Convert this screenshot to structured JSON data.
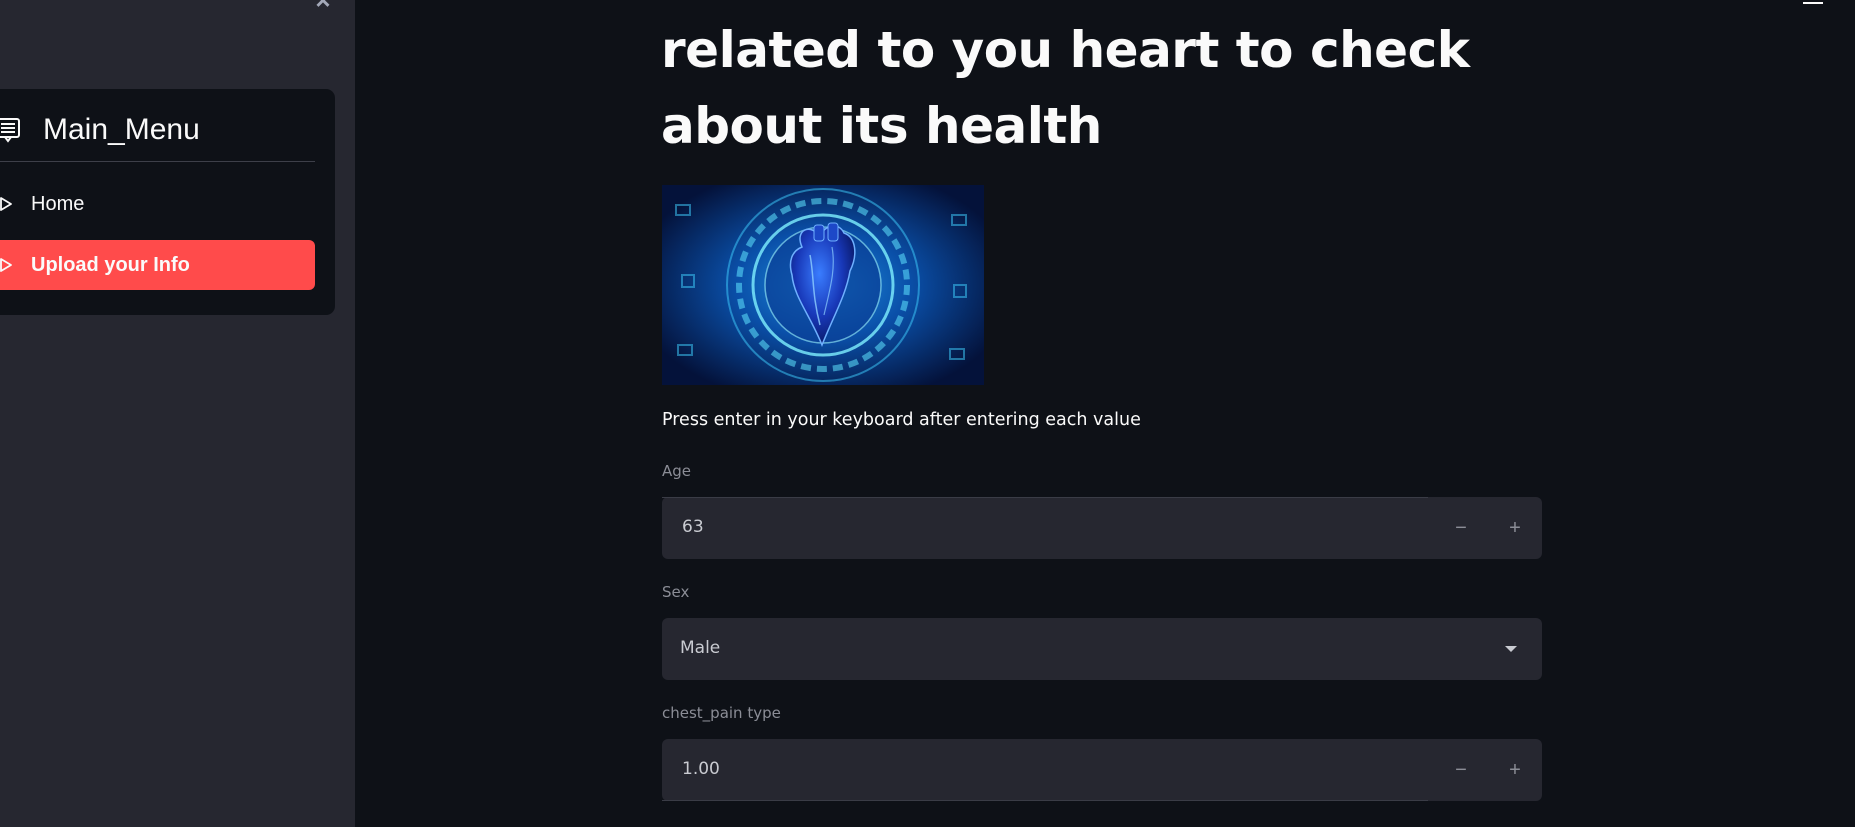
{
  "sidebar": {
    "close_glyph": "×",
    "menu_title": "Main_Menu",
    "menu_icon": "list-icon",
    "items": [
      {
        "label": "Home",
        "icon": "play-outline-icon",
        "active": false
      },
      {
        "label": "Upload your Info",
        "icon": "play-outline-icon",
        "active": true
      }
    ]
  },
  "main": {
    "title": "related to you heart to check about its health",
    "image_subject": "heart-image",
    "instruction": "Press enter in your keyboard after entering each value",
    "fields": {
      "age": {
        "label": "Age",
        "value": "63",
        "minus": "−",
        "plus": "+"
      },
      "sex": {
        "label": "Sex",
        "value": "Male"
      },
      "chest_pain": {
        "label": "chest_pain type",
        "value": "1.00",
        "minus": "−",
        "plus": "+"
      }
    }
  },
  "colors": {
    "background": "#0e1117",
    "sidebar": "#262730",
    "accent": "#ff4b4b",
    "input": "#262730"
  }
}
